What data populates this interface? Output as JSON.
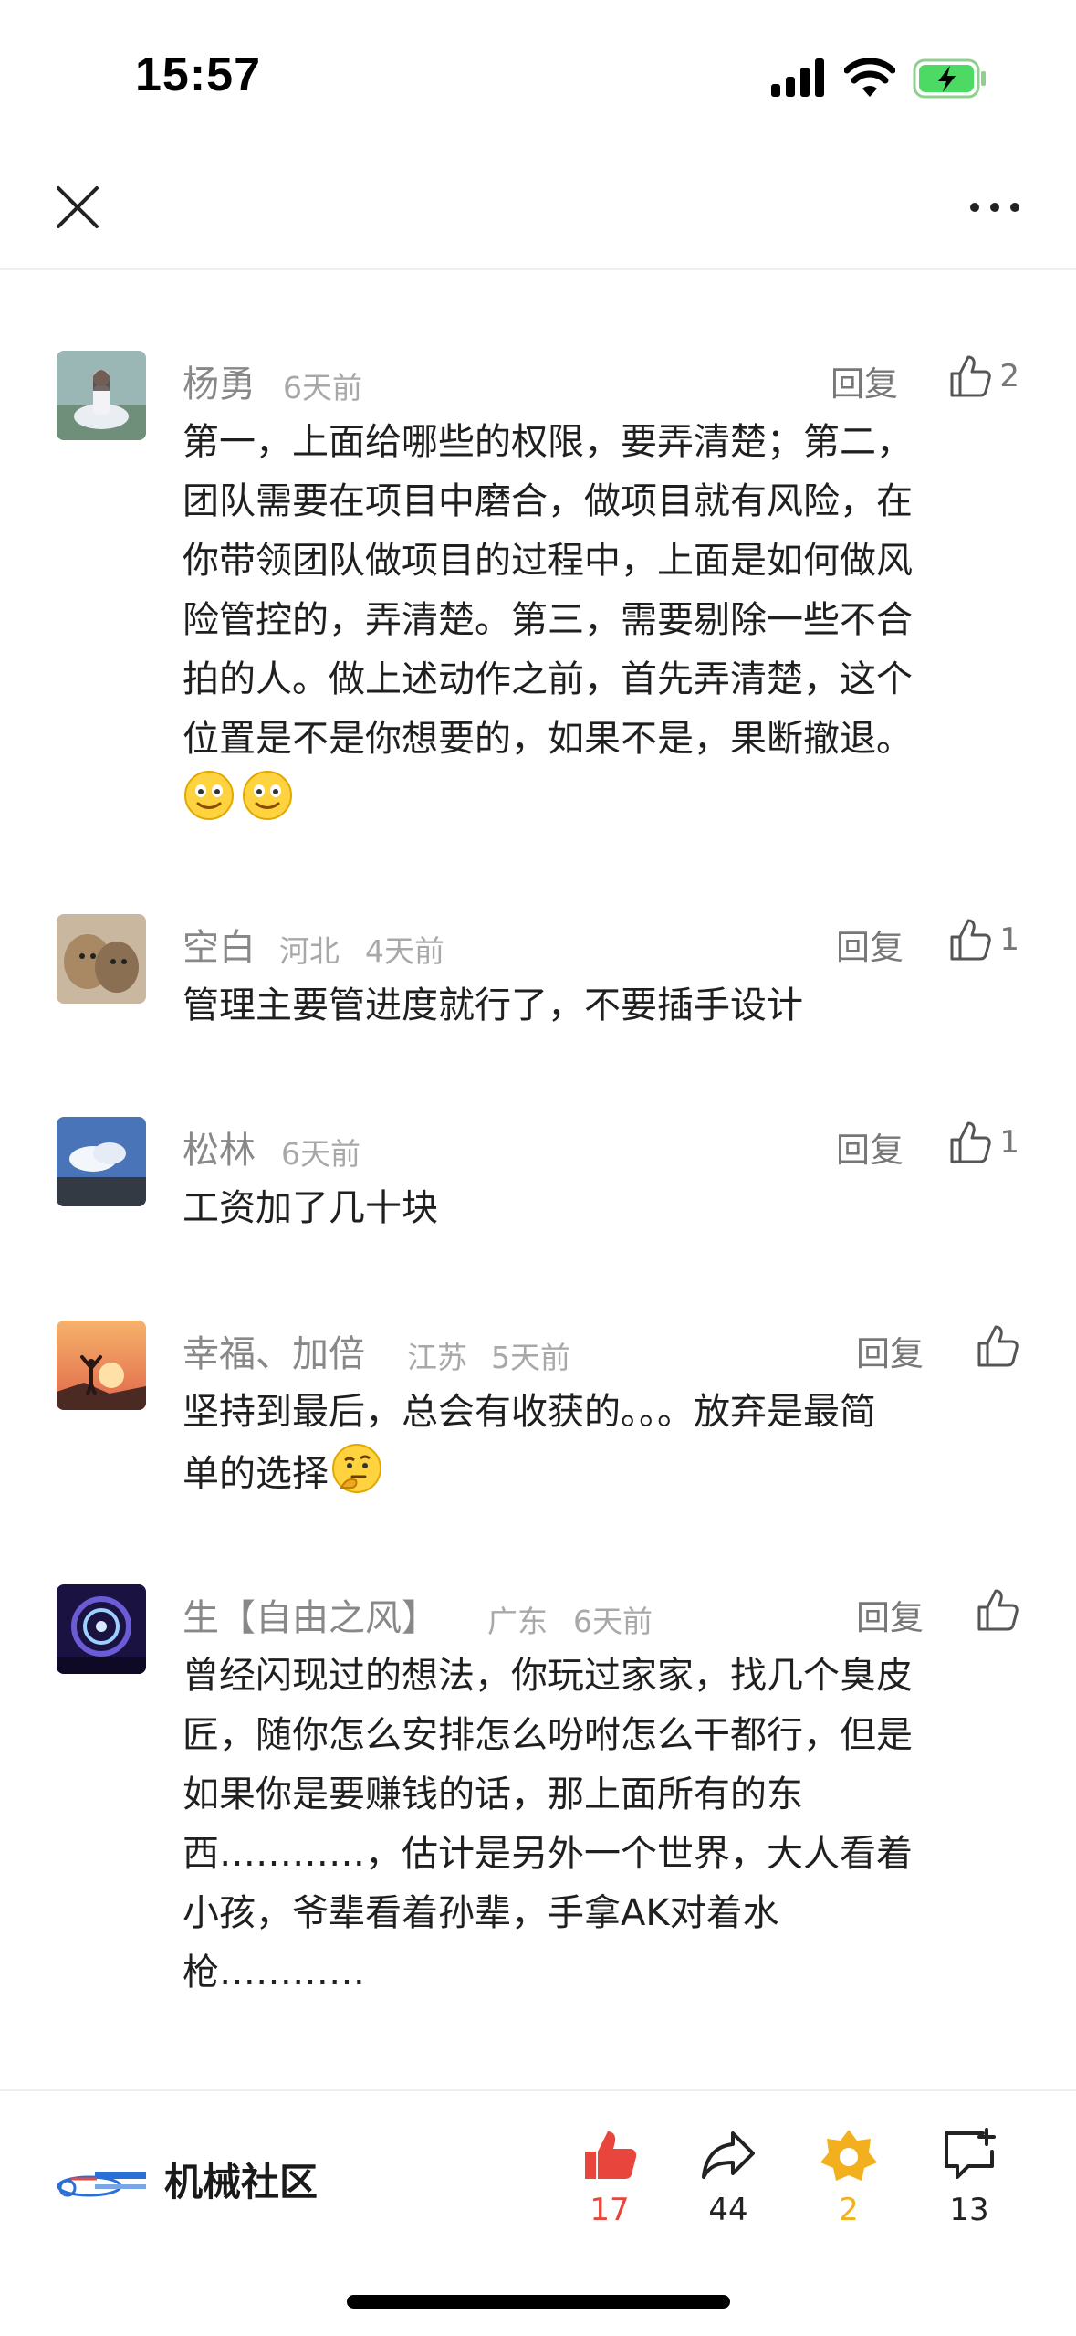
{
  "status_bar": {
    "time": "15:57"
  },
  "app": {
    "brand_name": "机械社区"
  },
  "comments": [
    {
      "name": "杨勇",
      "location": "",
      "time": "6天前",
      "reply": "回复",
      "likes": "2",
      "lines": [
        "第一，上面给哪些的权限，要弄清楚；第二，",
        "团队需要在项目中磨合，做项目就有风险，在",
        "你带领团队做项目的过程中，上面是如何做风",
        "险管控的，弄清楚。第三，需要剔除一些不合",
        "拍的人。做上述动作之前，首先弄清楚，这个",
        "位置是不是你想要的，如果不是，果断撤退。"
      ]
    },
    {
      "name": "空白",
      "location": "河北",
      "time": "4天前",
      "reply": "回复",
      "likes": "1",
      "lines": [
        "管理主要管进度就行了，不要插手设计"
      ]
    },
    {
      "name": "松林",
      "location": "",
      "time": "6天前",
      "reply": "回复",
      "likes": "1",
      "lines": [
        "工资加了几十块"
      ]
    },
    {
      "name": "幸福、加倍",
      "location": "江苏",
      "time": "5天前",
      "reply": "回复",
      "likes": "",
      "lines": [
        "坚持到最后，总会有收获的。。。放弃是最简",
        "单的选择"
      ]
    },
    {
      "name": "生【自由之风】",
      "location": "广东",
      "time": "6天前",
      "reply": "回复",
      "likes": "",
      "lines": [
        "曾经闪现过的想法，你玩过家家，找几个臭皮",
        "匠，随你怎么安排怎么吩咐怎么干都行，但是",
        "如果你是要赚钱的话，那上面所有的东",
        "西…………，估计是另外一个世界，大人看着",
        "小孩，爷辈看着孙辈，手拿AK对着水",
        "枪…………"
      ]
    }
  ],
  "actions": {
    "like_count": "17",
    "share_count": "44",
    "collect_count": "2",
    "comment_count": "13"
  },
  "colors": {
    "like_red": "#e8453c",
    "collect_yellow": "#f2b01e",
    "text_gray": "#777777"
  }
}
